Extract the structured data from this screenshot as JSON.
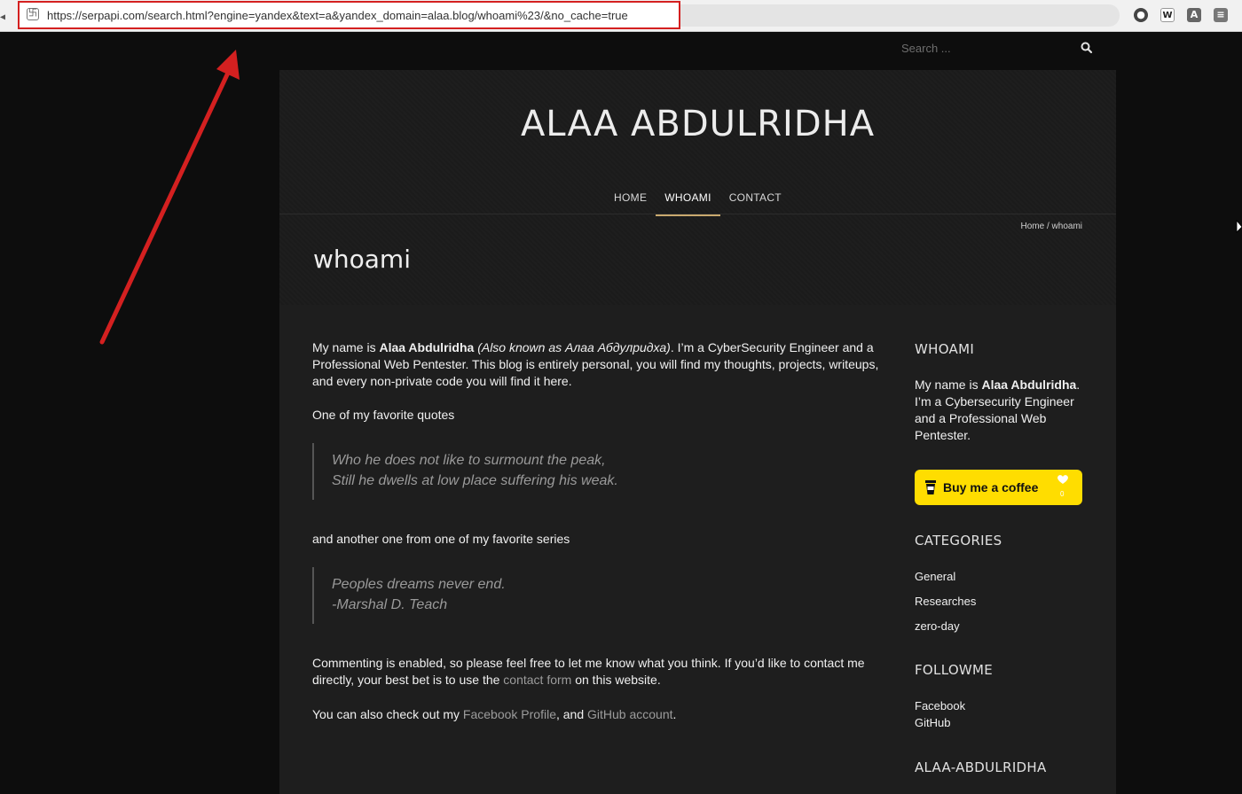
{
  "browser": {
    "url": "https://serpapi.com/search.html?engine=yandex&text=a&yandex_domain=alaa.blog/whoami%23/&no_cache=true",
    "extensions": [
      "shield-icon",
      "w-extension-icon",
      "translate-icon",
      "menu-icon"
    ]
  },
  "search": {
    "placeholder": "Search ..."
  },
  "site": {
    "title": "ALAA ABDULRIDHA"
  },
  "nav": {
    "items": [
      "HOME",
      "WHOAMI",
      "CONTACT"
    ],
    "active": "WHOAMI"
  },
  "breadcrumb": {
    "home": "Home",
    "separator": " / ",
    "current": "whoami"
  },
  "page": {
    "title": "whoami"
  },
  "content": {
    "intro_pre": "My name is ",
    "intro_name": "Alaa Abdulridha",
    "intro_aka": "(Also known as Алаа Абдулридха)",
    "intro_post": ". I’m a CyberSecurity Engineer and a Professional Web Pentester. This blog is entirely personal, you will find my thoughts, projects, writeups, and every non-private code you will find it here.",
    "quotes_intro": "One of my favorite quotes",
    "quote1_line1": "Who he does not like to surmount the peak,",
    "quote1_line2": "Still he dwells at low place suffering his weak.",
    "series_intro": "and another one from one of my favorite series",
    "quote2_line1": "Peoples dreams never end.",
    "quote2_line2": "-Marshal D. Teach",
    "comment_pre": "Commenting is enabled, so please feel free to let me know what you think. If you’d like to contact me directly, your best bet is to use the ",
    "comment_link": "contact form",
    "comment_post": " on this website.",
    "also_pre": "You can also check out my ",
    "also_link1": "Facebook Profile",
    "also_mid": ", and ",
    "also_link2": "GitHub account",
    "also_post": "."
  },
  "sidebar": {
    "whoami_title": "WHOAMI",
    "whoami_pre": "My name is  ",
    "whoami_name": "Alaa Abdulridha",
    "whoami_post": ". I’m a Cybersecurity Engineer and a Professional Web Pentester.",
    "bmc_label": "Buy me a coffee",
    "bmc_count": "0",
    "categories_title": "CATEGORIES",
    "categories": [
      "General",
      "Researches",
      "zero-day"
    ],
    "follow_title": "FOLLOWME",
    "follow": [
      "Facebook",
      "GitHub"
    ],
    "last_title": "ALAA-ABDULRIDHA"
  },
  "colors": {
    "accent": "#c9a96e",
    "annotation": "#d42020",
    "bmc": "#ffdd00",
    "background": "#0d0d0d",
    "panel": "#1e1e1e"
  }
}
